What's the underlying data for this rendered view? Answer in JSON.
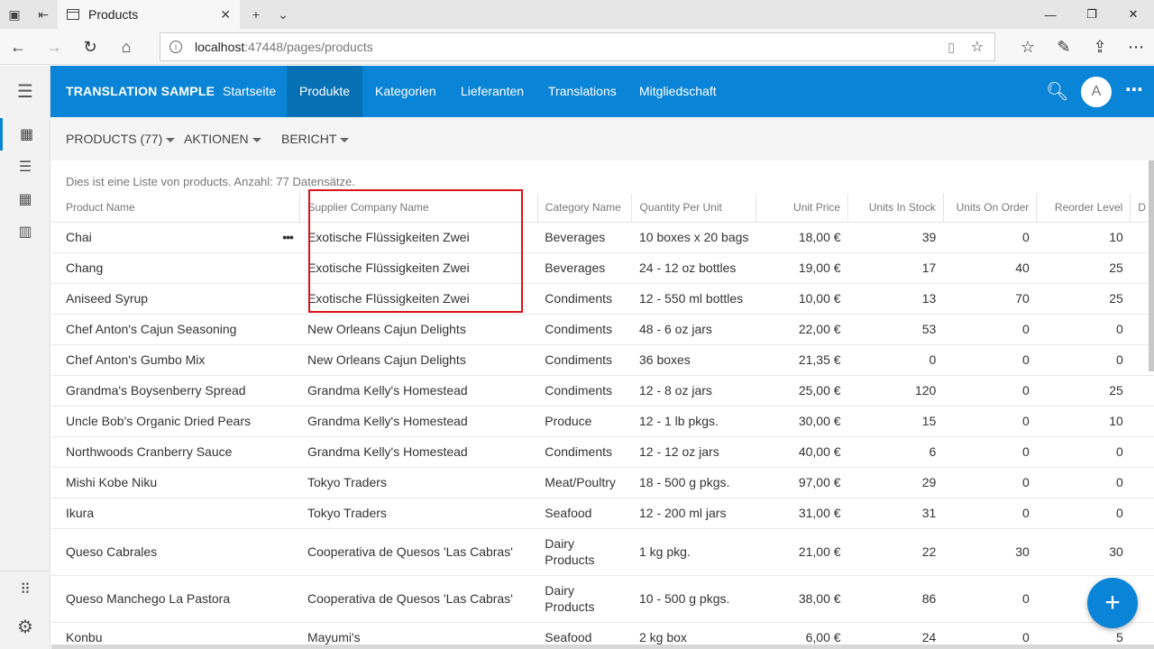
{
  "browser": {
    "tab_title": "Products",
    "url_host": "localhost",
    "url_path": ":47448/pages/products"
  },
  "app": {
    "brand": "TRANSLATION SAMPLE",
    "nav": [
      {
        "label": "Startseite"
      },
      {
        "label": "Produkte"
      },
      {
        "label": "Kategorien"
      },
      {
        "label": "Lieferanten"
      },
      {
        "label": "Translations"
      },
      {
        "label": "Mitgliedschaft"
      }
    ],
    "active_nav": "Produkte",
    "avatar_initial": "A"
  },
  "toolbar": {
    "products": "PRODUCTS (77)",
    "actions": "AKTIONEN",
    "report": "BERICHT"
  },
  "description": "Dies ist eine Liste von products. Anzahl: 77 Datensätze.",
  "table": {
    "columns": [
      "Product Name",
      "Supplier Company Name",
      "Category Name",
      "Quantity Per Unit",
      "Unit Price",
      "Units In Stock",
      "Units On Order",
      "Reorder Level",
      "D"
    ],
    "rows": [
      [
        "Chai",
        "Exotische Flüssigkeiten Zwei",
        "Beverages",
        "10 boxes x 20 bags",
        "18,00 €",
        "39",
        "0",
        "10"
      ],
      [
        "Chang",
        "Exotische Flüssigkeiten Zwei",
        "Beverages",
        "24 - 12 oz bottles",
        "19,00 €",
        "17",
        "40",
        "25"
      ],
      [
        "Aniseed Syrup",
        "Exotische Flüssigkeiten Zwei",
        "Condiments",
        "12 - 550 ml bottles",
        "10,00 €",
        "13",
        "70",
        "25"
      ],
      [
        "Chef Anton's Cajun Seasoning",
        "New Orleans Cajun Delights",
        "Condiments",
        "48 - 6 oz jars",
        "22,00 €",
        "53",
        "0",
        "0"
      ],
      [
        "Chef Anton's Gumbo Mix",
        "New Orleans Cajun Delights",
        "Condiments",
        "36 boxes",
        "21,35 €",
        "0",
        "0",
        "0"
      ],
      [
        "Grandma's Boysenberry Spread",
        "Grandma Kelly's Homestead",
        "Condiments",
        "12 - 8 oz jars",
        "25,00 €",
        "120",
        "0",
        "25"
      ],
      [
        "Uncle Bob's Organic Dried Pears",
        "Grandma Kelly's Homestead",
        "Produce",
        "12 - 1 lb pkgs.",
        "30,00 €",
        "15",
        "0",
        "10"
      ],
      [
        "Northwoods Cranberry Sauce",
        "Grandma Kelly's Homestead",
        "Condiments",
        "12 - 12 oz jars",
        "40,00 €",
        "6",
        "0",
        "0"
      ],
      [
        "Mishi Kobe Niku",
        "Tokyo Traders",
        "Meat/Poultry",
        "18 - 500 g pkgs.",
        "97,00 €",
        "29",
        "0",
        "0"
      ],
      [
        "Ikura",
        "Tokyo Traders",
        "Seafood",
        "12 - 200 ml jars",
        "31,00 €",
        "31",
        "0",
        "0"
      ],
      [
        "Queso Cabrales",
        "Cooperativa de Quesos 'Las Cabras'",
        "Dairy Products",
        "1 kg pkg.",
        "21,00 €",
        "22",
        "30",
        "30"
      ],
      [
        "Queso Manchego La Pastora",
        "Cooperativa de Quesos 'Las Cabras'",
        "Dairy Products",
        "10 - 500 g pkgs.",
        "38,00 €",
        "86",
        "0",
        ""
      ],
      [
        "Konbu",
        "Mayumi's",
        "Seafood",
        "2 kg box",
        "6,00 €",
        "24",
        "0",
        "5"
      ]
    ]
  },
  "fab_label": "+",
  "colors": {
    "accent": "#0a84d6",
    "highlight": "#d9121b"
  }
}
